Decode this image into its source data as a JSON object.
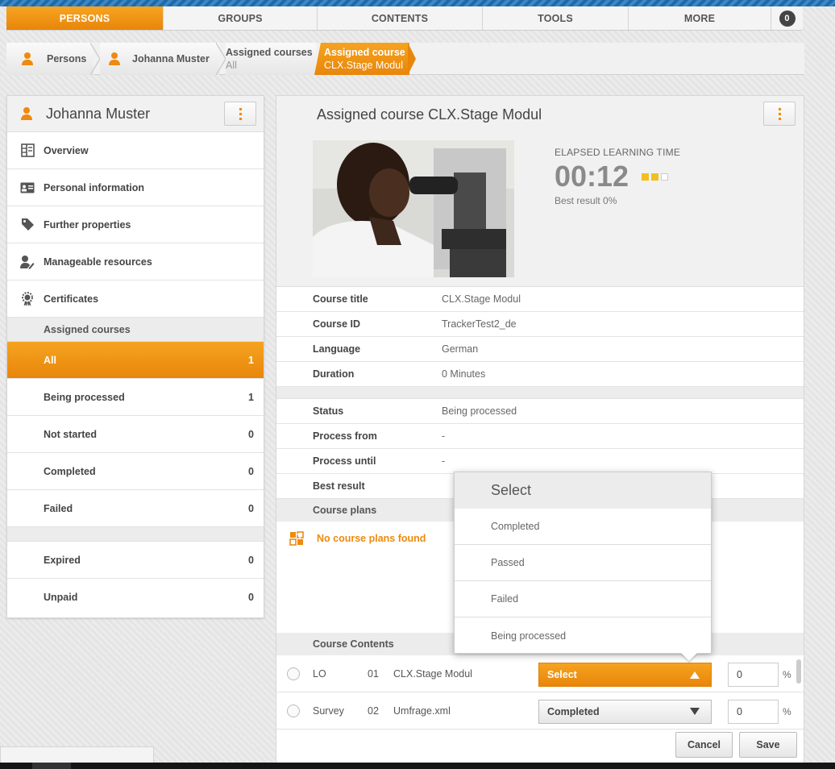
{
  "nav": {
    "items": [
      {
        "label": "PERSONS",
        "active": true
      },
      {
        "label": "GROUPS",
        "active": false
      },
      {
        "label": "CONTENTS",
        "active": false
      },
      {
        "label": "TOOLS",
        "active": false
      },
      {
        "label": "MORE",
        "active": false
      }
    ],
    "notification_count": "0"
  },
  "breadcrumb": {
    "persons": "Persons",
    "person": "Johanna Muster",
    "assigned_courses": "Assigned courses",
    "assigned_courses_sub": "All",
    "current": "Assigned course",
    "current_sub": "CLX.Stage Modul"
  },
  "sidebar": {
    "name": "Johanna Muster",
    "menu": [
      {
        "label": "Overview",
        "icon": "overview-icon"
      },
      {
        "label": "Personal information",
        "icon": "id-card-icon"
      },
      {
        "label": "Further properties",
        "icon": "tag-icon"
      },
      {
        "label": "Manageable resources",
        "icon": "user-edit-icon"
      },
      {
        "label": "Certificates",
        "icon": "certificate-icon"
      }
    ],
    "section_title": "Assigned courses",
    "filters": [
      {
        "label": "All",
        "count": "1",
        "active": true
      },
      {
        "label": "Being processed",
        "count": "1"
      },
      {
        "label": "Not started",
        "count": "0"
      },
      {
        "label": "Completed",
        "count": "0"
      },
      {
        "label": "Failed",
        "count": "0"
      }
    ],
    "filters2": [
      {
        "label": "Expired",
        "count": "0"
      },
      {
        "label": "Unpaid",
        "count": "0"
      }
    ]
  },
  "main": {
    "title": "Assigned course CLX.Stage Modul",
    "elapsed_label": "ELAPSED LEARNING TIME",
    "elapsed_time": "00:12",
    "best_result": "Best result 0%",
    "details": [
      {
        "key": "Course title",
        "value": "CLX.Stage Modul"
      },
      {
        "key": "Course ID",
        "value": "TrackerTest2_de"
      },
      {
        "key": "Language",
        "value": "German"
      },
      {
        "key": "Duration",
        "value": "0 Minutes"
      }
    ],
    "status": [
      {
        "key": "Status",
        "value": "Being processed"
      },
      {
        "key": "Process from",
        "value": "-"
      },
      {
        "key": "Process until",
        "value": "-"
      },
      {
        "key": "Best result",
        "value": ""
      }
    ],
    "course_plans_title": "Course plans",
    "no_plans": "No course plans found",
    "course_contents_title": "Course Contents",
    "contents": [
      {
        "type": "LO",
        "num": "01",
        "name": "CLX.Stage Modul",
        "status": "Select",
        "percent": "0"
      },
      {
        "type": "Survey",
        "num": "02",
        "name": "Umfrage.xml",
        "status": "Completed",
        "percent": "0"
      }
    ],
    "percent_sign": "%",
    "cancel": "Cancel",
    "save": "Save"
  },
  "dropdown_menu": {
    "header": "Select",
    "options": [
      "Completed",
      "Passed",
      "Failed",
      "Being processed"
    ]
  },
  "colors": {
    "accent": "#ee8a0f",
    "nav_blue": "#1d6aa8"
  }
}
